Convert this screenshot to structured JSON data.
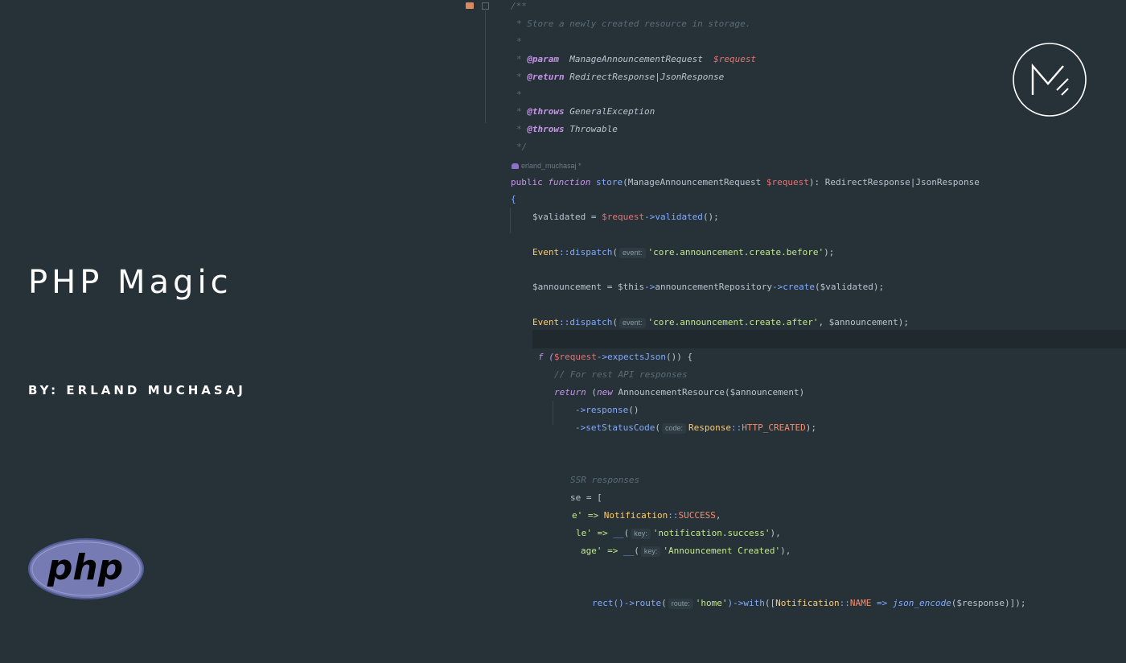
{
  "left": {
    "title": "PHP Magic",
    "byline": "BY: ERLAND MUCHASAJ",
    "php_logo_text": "php",
    "brand_logo_icon": "m-slash-logo-icon"
  },
  "editor": {
    "doc": {
      "open": "/**",
      "summary": "* Store a newly created resource in storage.",
      "blank": "*",
      "param_tag": "@param",
      "param_type": "ManageAnnouncementRequest",
      "param_var": "$request",
      "return_tag": "@return",
      "return_type": "RedirectResponse|JsonResponse",
      "throws_tag": "@throws",
      "throws_1": "GeneralException",
      "throws_2": "Throwable",
      "close": "*/"
    },
    "author": "erland_muchasaj *",
    "sig": {
      "public": "public",
      "function": "function",
      "name": "store",
      "open": "(ManageAnnouncementRequest ",
      "var": "$request",
      "close": "): RedirectResponse|JsonResponse"
    },
    "brace": "{",
    "l_validated": {
      "a": "$validated = ",
      "v": "$request",
      "arrow": "->",
      "fn": "validated",
      "end": "();"
    },
    "l_dispatch1": {
      "cls": "Event",
      "sep": "::",
      "fn": "dispatch",
      "p": "(",
      "hint": "event:",
      "str": "'core.announcement.create.before'",
      "end": ");"
    },
    "l_create": {
      "a": "$announcement = $this",
      "arrow1": "->",
      "repo": "announcementRepository",
      "arrow2": "->",
      "fn": "create",
      "end": "($validated);"
    },
    "l_dispatch2": {
      "cls": "Event",
      "sep": "::",
      "fn": "dispatch",
      "p": "(",
      "hint": "event:",
      "str": "'core.announcement.create.after'",
      "end": ", $announcement);"
    },
    "l_if": {
      "a": "f (",
      "v": "$request",
      "arrow": "->",
      "fn": "expectsJson",
      "end": "()) {"
    },
    "l_comment_rest": "// For rest API responses",
    "l_return": {
      "kw": "return",
      "a": " (",
      "kw2": "new",
      "cls": " AnnouncementResource",
      "end": "($announcement)"
    },
    "l_response": {
      "arrow": "->",
      "fn": "response",
      "end": "()"
    },
    "l_status": {
      "arrow": "->",
      "fn": "setStatusCode",
      "p": "(",
      "hint": "code:",
      "cls": "Response",
      "sep": "::",
      "const": "HTTP_CREATED",
      "end": ");"
    },
    "l_comment_ssr": "SSR responses",
    "l_se": "se = [",
    "l_type": {
      "a": "e' => ",
      "cls": "Notification",
      "sep": "::",
      "const": "SUCCESS",
      "end": ","
    },
    "l_title": {
      "a": "le' => ",
      "fn": "__",
      "p": "(",
      "hint": "key:",
      "str": "'notification.success'",
      "end": "),"
    },
    "l_message": {
      "a": "age' => ",
      "fn": "__",
      "p": "(",
      "hint": "key:",
      "str": "'Announcement Created'",
      "end": "),"
    },
    "l_redirect": {
      "a": "rect()",
      "arrow": "->",
      "fn": "route",
      "p": "(",
      "hint": "route:",
      "str": "'home'",
      "arrow2": ")->",
      "fn2": "with",
      "b": "([",
      "cls": "Notification",
      "sep": "::",
      "const": "NAME",
      "op": " => ",
      "fn3": "json_encode",
      "end": "($response)]);"
    }
  },
  "colors": {
    "background": "#263238",
    "keyword": "#c792ea",
    "function": "#82aaff",
    "string": "#c3e88d",
    "variable": "#e57373",
    "class": "#ffcb6b"
  }
}
